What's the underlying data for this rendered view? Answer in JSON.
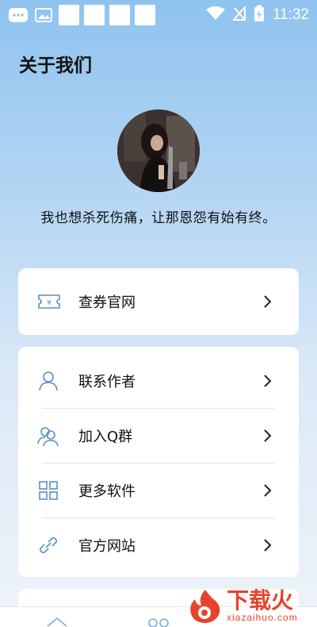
{
  "status_bar": {
    "time": "11:32"
  },
  "page_title": "关于我们",
  "motto": "我也想杀死伤痛，让那恩怨有始有终。",
  "card1": {
    "items": [
      {
        "label": "查券官网",
        "icon": "ticket-icon"
      }
    ]
  },
  "card2": {
    "items": [
      {
        "label": "联系作者",
        "icon": "user-icon"
      },
      {
        "label": "加入Q群",
        "icon": "group-icon"
      },
      {
        "label": "更多软件",
        "icon": "apps-grid-icon"
      },
      {
        "label": "官方网站",
        "icon": "link-icon"
      }
    ]
  },
  "watermark": {
    "cn": "下载火",
    "en": "xiazaihuo.com"
  },
  "colors": {
    "accent_icon": "#5a8fc6",
    "bg_top": "#8fc3ef",
    "watermark": "#e8432a"
  }
}
